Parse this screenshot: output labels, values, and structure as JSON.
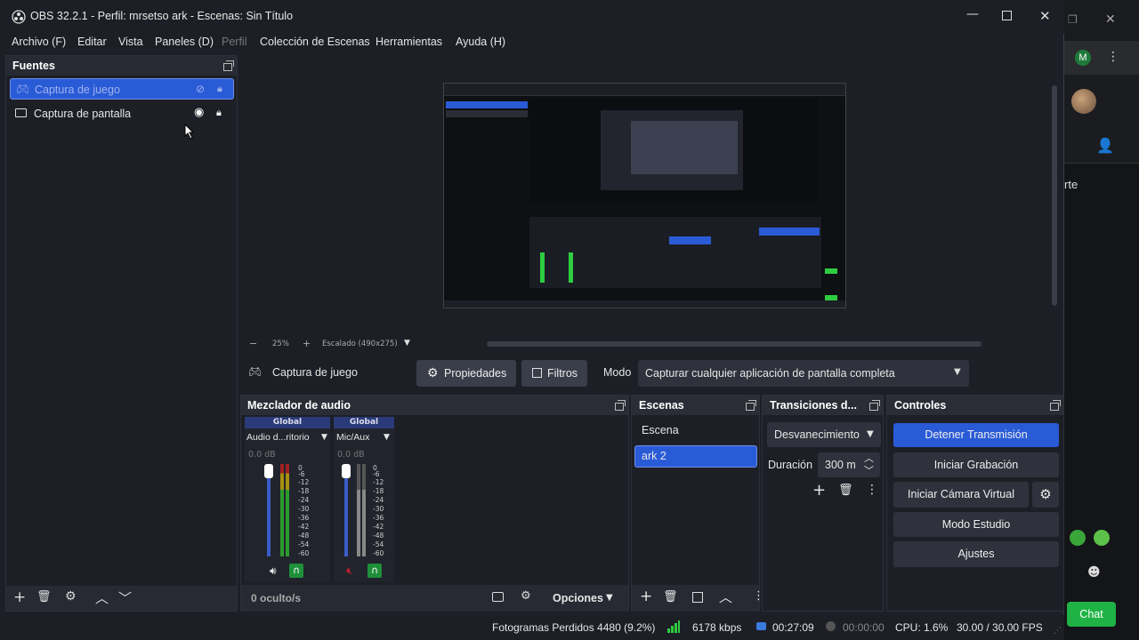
{
  "window": {
    "title": "OBS 32.2.1 - Perfil: mrsetso ark - Escenas: Sin Título"
  },
  "menu": [
    "Archivo (F)",
    "Editar",
    "Vista",
    "Paneles (D)",
    "Perfil",
    "Colección de Escenas",
    "Herramientas",
    "Ayuda (H)"
  ],
  "sources": {
    "title": "Fuentes",
    "items": [
      {
        "label": "Captura de juego",
        "selected": true,
        "visible": false,
        "locked": true
      },
      {
        "label": "Captura de pantalla",
        "selected": false,
        "visible": true,
        "locked": true
      }
    ]
  },
  "preview": {
    "zoom": "25%",
    "scale_label": "Escalado (490x275)"
  },
  "props_bar": {
    "source_name": "Captura de juego",
    "properties_label": "Propiedades",
    "filters_label": "Filtros",
    "mode_label": "Modo",
    "mode_value": "Capturar cualquier aplicación de pantalla completa"
  },
  "mixer": {
    "title": "Mezclador de audio",
    "channels": [
      {
        "badge": "Global",
        "name": "Audio d...ritorio",
        "db": "0.0 dB",
        "muted": false
      },
      {
        "badge": "Global",
        "name": "Mic/Aux",
        "db": "0.0 dB",
        "muted": true
      }
    ],
    "ticks": [
      "0",
      "-6",
      "-12",
      "-18",
      "-24",
      "-30",
      "-36",
      "-42",
      "-48",
      "-54",
      "-60"
    ],
    "hidden_label": "0 oculto/s",
    "options_label": "Opciones"
  },
  "scenes": {
    "title": "Escenas",
    "items": [
      {
        "label": "Escena",
        "selected": false
      },
      {
        "label": "ark 2",
        "selected": true
      }
    ]
  },
  "transitions": {
    "title": "Transiciones d...",
    "selected": "Desvanecimiento",
    "duration_label": "Duración",
    "duration_value": "300 m"
  },
  "controls": {
    "title": "Controles",
    "stop_stream": "Detener Transmisión",
    "start_recording": "Iniciar Grabación",
    "start_virtual_cam": "Iniciar Cámara Virtual",
    "studio_mode": "Modo Estudio",
    "settings": "Ajustes"
  },
  "status": {
    "dropped_frames": "Fotogramas Perdidos 4480 (9.2%)",
    "bitrate": "6178 kbps",
    "stream_time": "00:27:09",
    "record_time": "00:00:00",
    "cpu": "CPU: 1.6%",
    "fps": "30.00 / 30.00 FPS"
  },
  "browser_bg": {
    "avatar_letter": "M",
    "partial_text": "rte",
    "chat_label": "Chat"
  },
  "colors": {
    "accent": "#2a5bd7",
    "panel": "#272a33",
    "background": "#1d1f26",
    "green": "#2ecc40",
    "chat_green": "#1fb345"
  }
}
